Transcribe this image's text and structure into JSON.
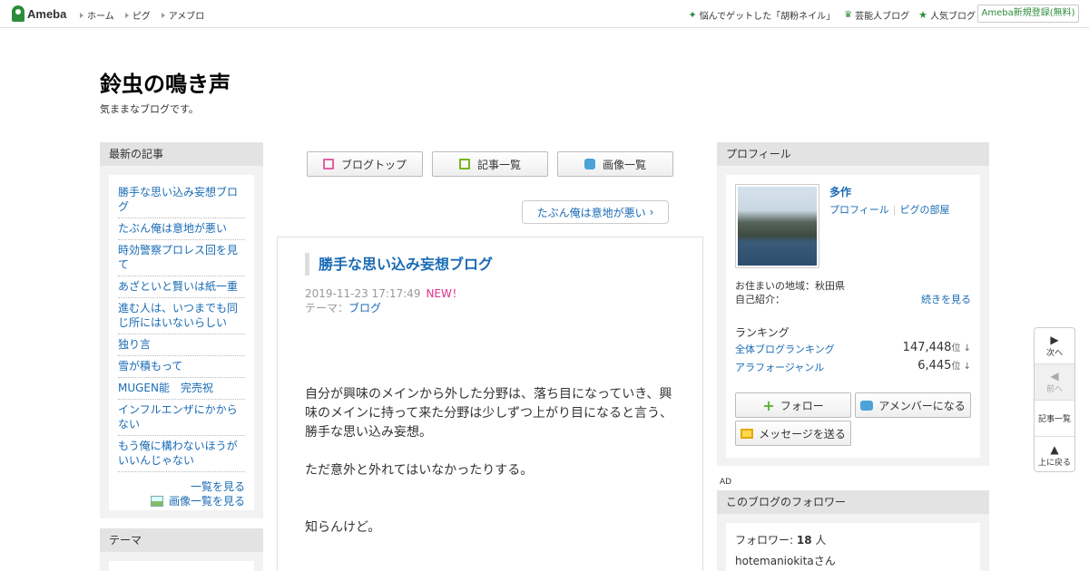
{
  "topbar": {
    "logo": "Ameba",
    "nav_left": [
      "ホーム",
      "ピグ",
      "アメブロ"
    ],
    "nav_right": [
      {
        "icon": "star-icon",
        "label": "悩んでゲットした「胡粉ネイル」"
      },
      {
        "icon": "crown-icon",
        "label": "芸能人ブログ"
      },
      {
        "icon": "star-icon",
        "label": "人気ブログ"
      }
    ],
    "signup": "Ameba新規登録(無料)"
  },
  "blog": {
    "title": "鈴虫の鳴き声",
    "description": "気ままなブログです。"
  },
  "recent": {
    "heading": "最新の記事",
    "items": [
      "勝手な思い込み妄想ブログ",
      "たぶん俺は意地が悪い",
      "時効警察プロレス回を見て",
      "あざといと賢いは紙一重",
      "進む人は、いつまでも同じ所にはいないらしい",
      "独り言",
      "雪が積もって",
      "MUGEN能　完売祝",
      "インフルエンザにかからない",
      "もう俺に構わないほうがいいんじゃない"
    ],
    "see_all": "一覧を見る",
    "see_images": "画像一覧を見る"
  },
  "theme": {
    "heading": "テーマ"
  },
  "toolbar": {
    "blog_top": "ブログトップ",
    "articles": "記事一覧",
    "images": "画像一覧"
  },
  "next_post": "たぶん俺は意地が悪い",
  "article": {
    "title": "勝手な思い込み妄想ブログ",
    "date": "2019-11-23 17:17:49",
    "new_label": "NEW！",
    "theme_prefix": "テーマ：",
    "theme": "ブログ",
    "paragraphs": [
      "自分が興味のメインから外した分野は、落ち目になっていき、興味のメインに持って来た分野は少しずつ上がり目になると言う、勝手な思い込み妄想。",
      "ただ意外と外れてはいなかったりする。",
      "知らんけど。"
    ]
  },
  "profile": {
    "heading": "プロフィール",
    "name": "多作",
    "link_profile": "プロフィール",
    "link_pigg": "ピグの部屋",
    "area": "お住まいの地域：秋田県",
    "intro": "自己紹介：",
    "more": "続きを見る",
    "ranking_label": "ランキング",
    "rankings": [
      {
        "name": "全体ブログランキング",
        "value": "147,448",
        "unit": "位"
      },
      {
        "name": "アラフォージャンル",
        "value": "6,445",
        "unit": "位"
      }
    ],
    "follow": "フォロー",
    "member": "アメンバーになる",
    "message": "メッセージを送る"
  },
  "ad_label": "AD",
  "followers": {
    "heading": "このブログのフォロワー",
    "count_label": "フォロワー:",
    "count": "18",
    "count_unit": "人",
    "first": "hotemaniokitaさん"
  },
  "sidenav": {
    "next": "次へ",
    "prev": "前へ",
    "list": "記事一覧",
    "top": "上に戻る"
  }
}
